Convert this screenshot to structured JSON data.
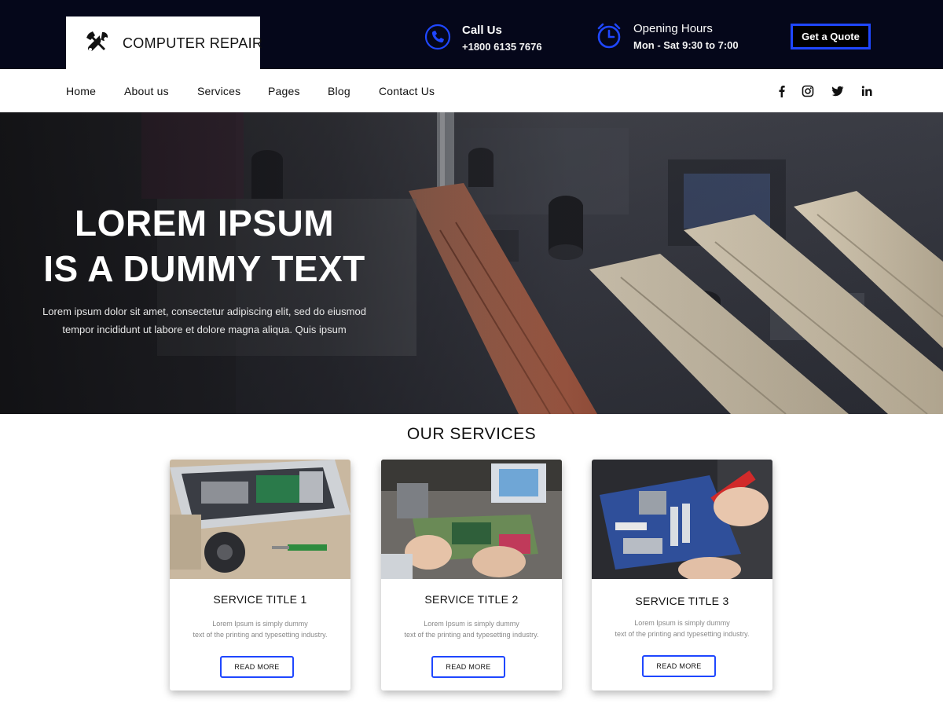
{
  "brand": {
    "name": "COMPUTER REPAIR",
    "icon": "tools-icon"
  },
  "contact": {
    "call_title": "Call Us",
    "call_value": "+1800 6135 7676",
    "hours_title": "Opening Hours",
    "hours_value": "Mon - Sat  9:30 to 7:00",
    "quote_label": "Get a Quote"
  },
  "nav": {
    "items": [
      "Home",
      "About us",
      "Services",
      "Pages",
      "Blog",
      "Contact Us"
    ],
    "social": [
      "facebook-icon",
      "instagram-icon",
      "twitter-icon",
      "linkedin-icon"
    ]
  },
  "hero": {
    "line1": "LOREM IPSUM",
    "line2": "IS A DUMMY TEXT",
    "sub1": "Lorem ipsum dolor sit amet, consectetur adipiscing elit, sed do eiusmod",
    "sub2": "tempor incididunt ut labore et dolore magna aliqua. Quis ipsum"
  },
  "services": {
    "heading": "OUR SERVICES",
    "cards": [
      {
        "title": "SERVICE TITLE 1",
        "desc1": "Lorem Ipsum is simply dummy",
        "desc2": "text of the printing and typesetting industry.",
        "button": "READ MORE"
      },
      {
        "title": "SERVICE TITLE 2",
        "desc1": "Lorem Ipsum is simply dummy",
        "desc2": "text of the printing and typesetting industry.",
        "button": "READ MORE"
      },
      {
        "title": "SERVICE TITLE 3",
        "desc1": "Lorem Ipsum is simply dummy",
        "desc2": "text of the printing and typesetting industry.",
        "button": "READ MORE"
      }
    ]
  },
  "colors": {
    "topbar": "#05071a",
    "accent": "#1f47ff",
    "white": "#ffffff"
  }
}
